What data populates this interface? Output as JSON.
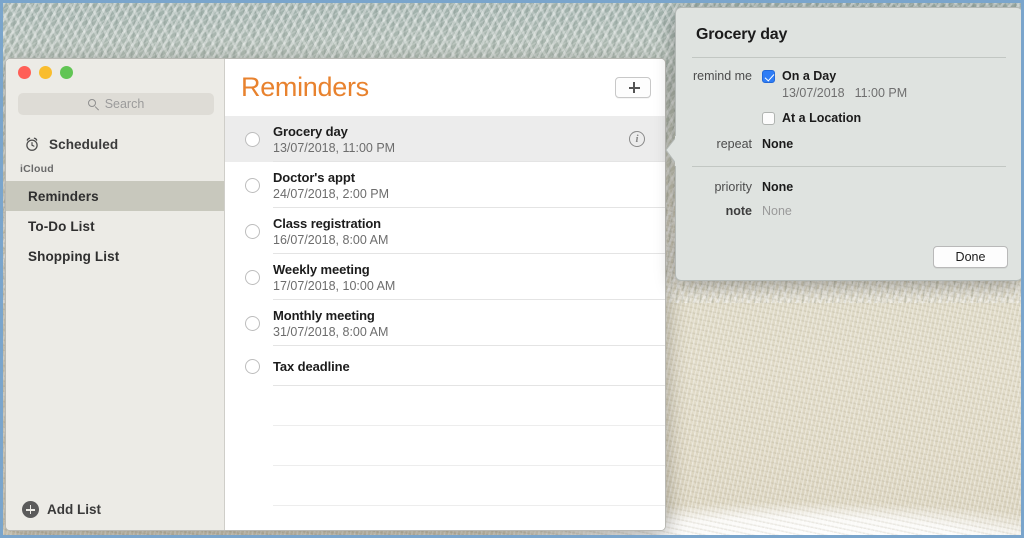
{
  "window": {
    "traffic_lights": [
      {
        "name": "close",
        "color": "#ff5f57"
      },
      {
        "name": "minimize",
        "color": "#f9bd2e"
      },
      {
        "name": "zoom",
        "color": "#61c554"
      }
    ]
  },
  "sidebar": {
    "search": {
      "placeholder": "Search",
      "value": "",
      "icon": "search-icon"
    },
    "scheduled": {
      "label": "Scheduled",
      "icon": "alarm-clock-icon"
    },
    "group_header": "iCloud",
    "lists": [
      {
        "label": "Reminders",
        "selected": true
      },
      {
        "label": "To-Do List",
        "selected": false
      },
      {
        "label": "Shopping List",
        "selected": false
      }
    ],
    "add_list": {
      "label": "Add List",
      "icon": "plus-circle-icon"
    }
  },
  "content": {
    "title": "Reminders",
    "title_color": "#e8822e",
    "add_button": {
      "icon": "plus-icon",
      "label": "+"
    },
    "reminders": [
      {
        "title": "Grocery day",
        "date": "13/07/2018, 11:00 PM",
        "selected": true,
        "has_info": true
      },
      {
        "title": "Doctor's appt",
        "date": "24/07/2018, 2:00 PM",
        "selected": false,
        "has_info": false
      },
      {
        "title": "Class registration",
        "date": "16/07/2018, 8:00 AM",
        "selected": false,
        "has_info": false
      },
      {
        "title": "Weekly meeting",
        "date": "17/07/2018, 10:00 AM",
        "selected": false,
        "has_info": false
      },
      {
        "title": "Monthly meeting",
        "date": "31/07/2018, 8:00 AM",
        "selected": false,
        "has_info": false
      },
      {
        "title": "Tax deadline",
        "date": "",
        "selected": false,
        "has_info": false
      }
    ],
    "empty_row_count": 4
  },
  "popover": {
    "title": "Grocery day",
    "remind_me_label": "remind me",
    "on_a_day": {
      "label": "On a Day",
      "checked": true
    },
    "date": "13/07/2018",
    "time": "11:00 PM",
    "at_a_location": {
      "label": "At a Location",
      "checked": false
    },
    "repeat_label": "repeat",
    "repeat_value": "None",
    "priority_label": "priority",
    "priority_value": "None",
    "note_label": "note",
    "note_value": "None",
    "done_label": "Done",
    "accent_color": "#2e7df6"
  }
}
